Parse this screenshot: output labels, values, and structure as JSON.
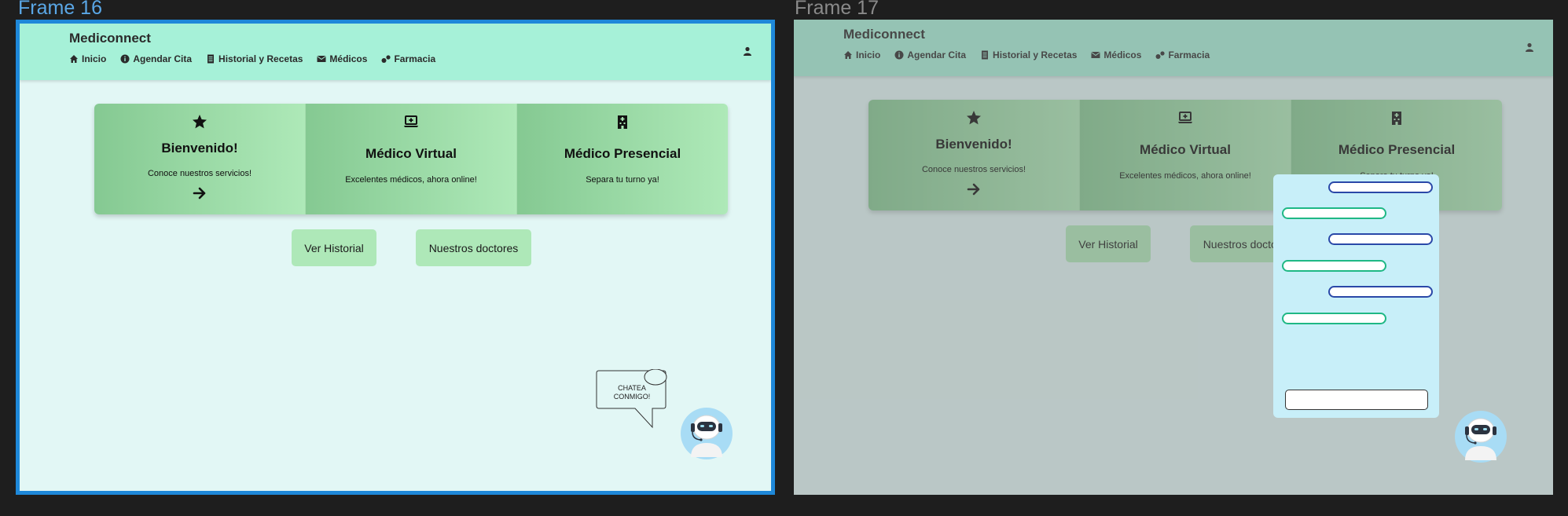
{
  "canvas": {
    "frames": [
      {
        "label": "Frame 16"
      },
      {
        "label": "Frame 17"
      }
    ]
  },
  "app": {
    "brand": "Mediconnect",
    "nav": [
      {
        "label": "Inicio",
        "icon": "home-icon"
      },
      {
        "label": "Agendar Cita",
        "icon": "info-circle-icon"
      },
      {
        "label": "Historial y Recetas",
        "icon": "document-icon"
      },
      {
        "label": "Médicos",
        "icon": "envelope-icon"
      },
      {
        "label": "Farmacia",
        "icon": "pills-icon"
      }
    ],
    "user_icon": "user-icon",
    "cards": [
      {
        "icon": "star-icon",
        "title": "Bienvenido!",
        "desc": "Conoce nuestros servicios!",
        "action_icon": "arrow-right-icon"
      },
      {
        "icon": "laptop-medical-icon",
        "title": "Médico Virtual",
        "desc": "Excelentes médicos, ahora online!"
      },
      {
        "icon": "hospital-icon",
        "title": "Médico Presencial",
        "desc": "Separa tu turno ya!"
      }
    ],
    "buttons": {
      "historial": "Ver Historial",
      "doctores": "Nuestros doctores"
    },
    "chat_prompt": "CHATEA CONMIGO!",
    "bot_icon": "robot-avatar-icon"
  },
  "colors": {
    "navbar": "#a6f1d8",
    "page_background": "#e2f7f5",
    "card_gradient_start": "#85c992",
    "card_gradient_end": "#aee9b8",
    "button": "#aee8b8",
    "selected_frame_border": "#1e88d9",
    "chat_panel": "#c8eff9",
    "chat_user_bubble_border": "#2a48a8",
    "chat_bot_bubble_border": "#1fb885"
  },
  "chat_window": {
    "bubbles": [
      "user",
      "bot",
      "user",
      "bot",
      "user",
      "bot"
    ]
  }
}
